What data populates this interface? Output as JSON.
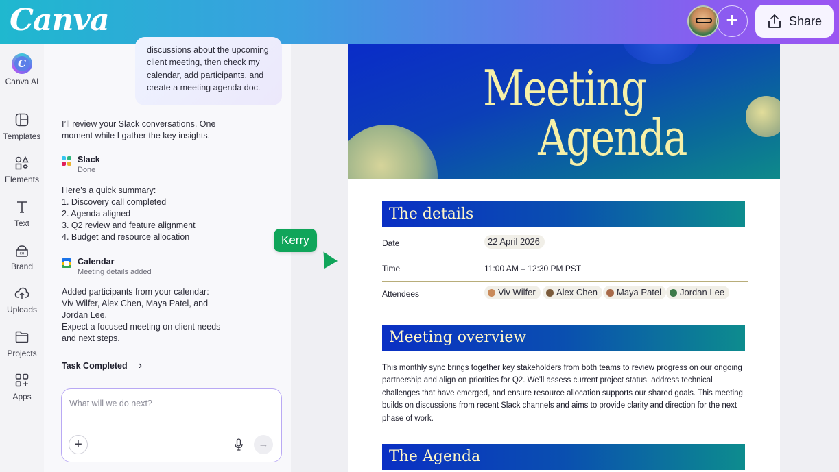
{
  "header": {
    "logo": "Canva",
    "share_label": "Share",
    "add_symbol": "+"
  },
  "rail": {
    "items": [
      {
        "label": "Canva AI",
        "icon": "canva-ai-icon"
      },
      {
        "label": "Templates",
        "icon": "templates-icon"
      },
      {
        "label": "Elements",
        "icon": "elements-icon"
      },
      {
        "label": "Text",
        "icon": "text-icon"
      },
      {
        "label": "Brand",
        "icon": "brand-icon"
      },
      {
        "label": "Uploads",
        "icon": "uploads-icon"
      },
      {
        "label": "Projects",
        "icon": "projects-icon"
      },
      {
        "label": "Apps",
        "icon": "apps-icon"
      }
    ]
  },
  "chat": {
    "user_message_lines": [
      "discussions about the upcoming",
      "client meeting, then check my",
      "calendar, add participants, and",
      "create a meeting agenda doc."
    ],
    "reply_1_lines": [
      "I’ll review your Slack conversations. One",
      "moment while I gather the key insights."
    ],
    "slack_tool": {
      "name": "Slack",
      "status": "Done"
    },
    "summary_lines": [
      "Here’s a quick summary:",
      " 1. Discovery call completed",
      " 2. Agenda aligned",
      " 3. Q2 review and feature alignment",
      " 4. Budget and resource allocation"
    ],
    "calendar_tool": {
      "name": "Calendar",
      "status": "Meeting details added"
    },
    "participants_lines": [
      "Added participants from your calendar:",
      "Viv Wilfer, Alex Chen, Maya Patel, and",
      "Jordan Lee.",
      "Expect a focused meeting on client needs",
      "and next steps."
    ],
    "task_completed": "Task Completed",
    "chevron": "›",
    "input_placeholder": "What will we do next?",
    "plus_symbol": "+",
    "send_symbol": "→"
  },
  "cursor": {
    "name": "Kerry",
    "color": "#10a55a"
  },
  "document": {
    "title_line_1": "Meeting",
    "title_line_2": "Agenda",
    "details_heading": "The details",
    "date_label": "Date",
    "date_value": "22 April 2026",
    "time_label": "Time",
    "time_value": "11:00 AM – 12:30 PM PST",
    "attendees_label": "Attendees",
    "attendees": [
      {
        "name": "Viv Wilfer",
        "color": "#c98a5a"
      },
      {
        "name": "Alex Chen",
        "color": "#7a5a3a"
      },
      {
        "name": "Maya Patel",
        "color": "#a86a4a"
      },
      {
        "name": "Jordan Lee",
        "color": "#3d7a4a"
      }
    ],
    "overview_heading": "Meeting overview",
    "overview_lines": [
      "This monthly sync brings together key stakeholders from both teams to review progress on our ongoing",
      "partnership and align on priorities for Q2. We’ll assess current project status, address technical",
      "challenges that have emerged, and ensure resource allocation supports our shared goals. This meeting",
      "builds on discussions from recent Slack channels and aims to provide clarity and direction for the next",
      "phase of work."
    ],
    "agenda_heading": "The Agenda"
  }
}
